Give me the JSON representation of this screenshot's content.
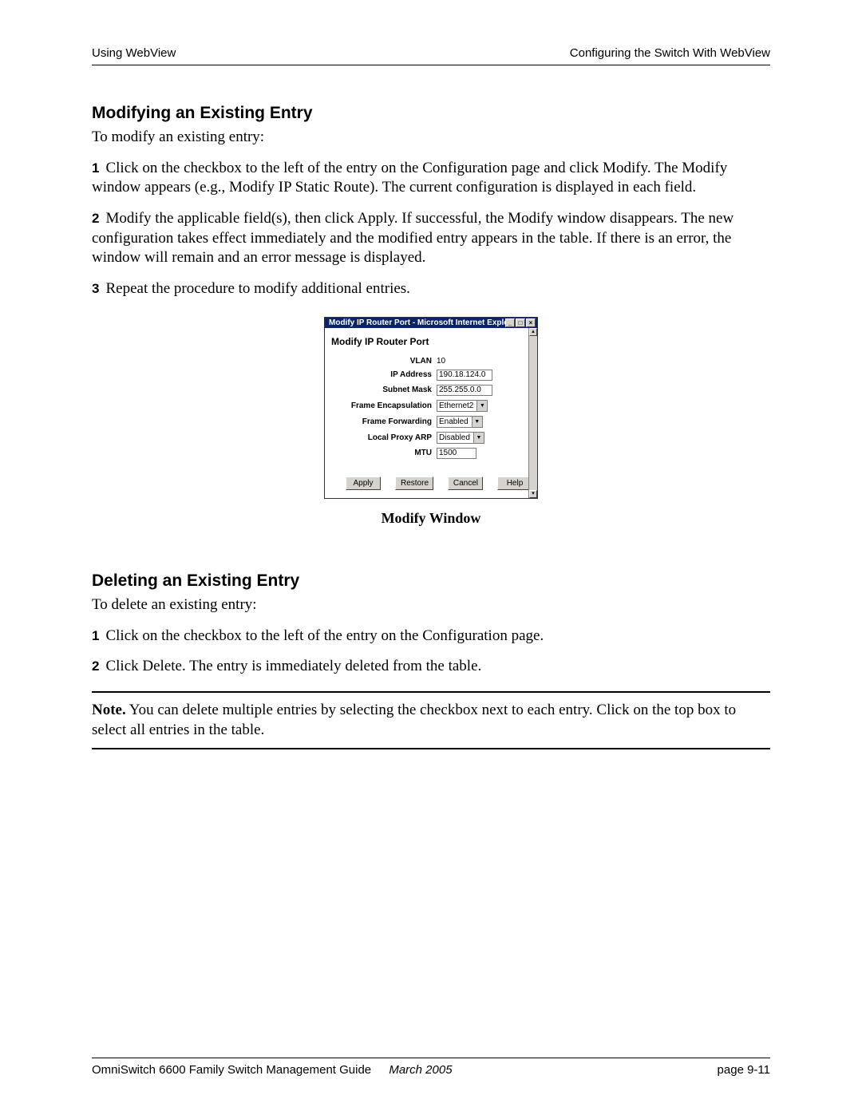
{
  "header": {
    "left": "Using WebView",
    "right": "Configuring the Switch With WebView"
  },
  "section1": {
    "title": "Modifying an Existing Entry",
    "intro": "To modify an existing entry:",
    "steps": [
      "Click on the checkbox to the left of the entry on the Configuration page and click Modify. The Modify window appears (e.g., Modify IP Static Route). The current configuration is displayed in each field.",
      "Modify the applicable field(s), then click Apply. If successful, the Modify window disappears. The new configuration takes effect immediately and the modified entry appears in the table. If there is an error, the window will remain and an error message is displayed.",
      "Repeat the procedure to modify additional entries."
    ]
  },
  "ie_window": {
    "title": "Modify IP Router Port - Microsoft Internet Explorer",
    "form_title": "Modify IP Router Port",
    "fields": {
      "vlan": {
        "label": "VLAN",
        "value": "10"
      },
      "ip": {
        "label": "IP Address",
        "value": "190.18.124.0"
      },
      "mask": {
        "label": "Subnet Mask",
        "value": "255.255.0.0"
      },
      "encap": {
        "label": "Frame Encapsulation",
        "value": "Ethernet2"
      },
      "fwd": {
        "label": "Frame Forwarding",
        "value": "Enabled"
      },
      "arp": {
        "label": "Local Proxy ARP",
        "value": "Disabled"
      },
      "mtu": {
        "label": "MTU",
        "value": "1500"
      }
    },
    "buttons": {
      "apply": "Apply",
      "restore": "Restore",
      "cancel": "Cancel",
      "help": "Help"
    },
    "caption": "Modify Window"
  },
  "section2": {
    "title": "Deleting an Existing Entry",
    "intro": "To delete an existing entry:",
    "steps": [
      "Click on the checkbox to the left of the entry on the Configuration page.",
      "Click Delete. The entry is immediately deleted from the table."
    ]
  },
  "note": {
    "label": "Note.",
    "text": " You can delete multiple entries by selecting the checkbox next to each entry. Click on the top box to select all entries in the table."
  },
  "footer": {
    "guide": "OmniSwitch 6600 Family Switch Management Guide",
    "date": "March 2005",
    "page": "page 9-11"
  }
}
